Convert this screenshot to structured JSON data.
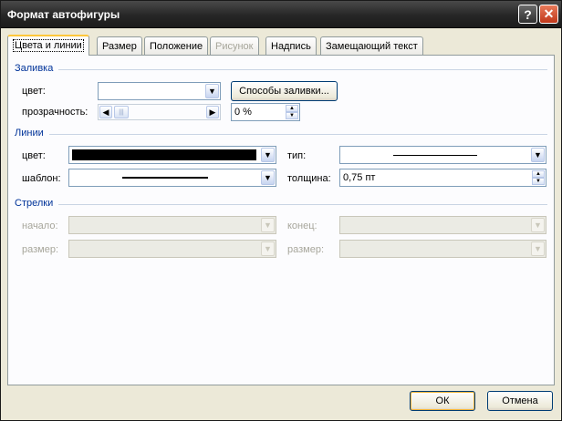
{
  "window": {
    "title": "Формат автофигуры",
    "help_glyph": "?",
    "close_glyph": "✕"
  },
  "tabs": [
    {
      "label": "Цвета и линии",
      "state": "active"
    },
    {
      "label": "Размер",
      "state": "normal"
    },
    {
      "label": "Положение",
      "state": "normal"
    },
    {
      "label": "Рисунок",
      "state": "disabled"
    },
    {
      "label": "Надпись",
      "state": "normal"
    },
    {
      "label": "Замещающий текст",
      "state": "normal"
    }
  ],
  "fill": {
    "section_title": "Заливка",
    "color_label": "цвет:",
    "color_value": "",
    "fill_effects_button": "Способы заливки...",
    "transparency_label": "прозрачность:",
    "transparency_level": 0,
    "transparency_value": "0 %"
  },
  "lines": {
    "section_title": "Линии",
    "color_label": "цвет:",
    "color_hex": "#000000",
    "type_label": "тип:",
    "pattern_label": "шаблон:",
    "weight_label": "толщина:",
    "weight_value": "0,75 пт"
  },
  "arrows": {
    "section_title": "Стрелки",
    "begin_style_label": "начало:",
    "end_style_label": "конец:",
    "begin_size_label": "размер:",
    "end_size_label": "размер:"
  },
  "buttons": {
    "ok": "ОК",
    "cancel": "Отмена"
  },
  "icons": {
    "dropdown": "▼",
    "left": "◀",
    "right": "▶",
    "up": "▲",
    "down": "▼",
    "thumb": "|||"
  },
  "colors": {
    "accent": "#003399",
    "active_tab_highlight": "#ffc73c"
  }
}
